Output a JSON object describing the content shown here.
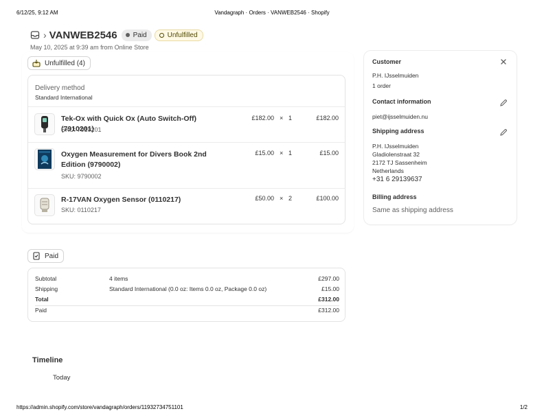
{
  "print": {
    "date": "6/12/25, 9:12 AM",
    "title": "Vandagraph · Orders · VANWEB2546 · Shopify",
    "url": "https://admin.shopify.com/store/vandagraph/orders/11932734751101",
    "page": "1/2"
  },
  "order": {
    "number": "VANWEB2546",
    "payment_badge": "Paid",
    "fulfillment_badge": "Unfulfilled",
    "subtitle": "May 10, 2025 at 9:39 am from Online Store"
  },
  "fulfillment": {
    "status_label": "Unfulfilled (4)",
    "delivery_method_title": "Delivery method",
    "delivery_method_value": "Standard International",
    "line_items": [
      {
        "name": "Tek-Ox with Quick Ox (Auto Switch-Off) (7910201)",
        "sku": "SKU: 7910201",
        "price": "£182.00",
        "times": "×",
        "qty": "1",
        "total": "£182.00",
        "thumb_icon": "oxygen-analyser-icon"
      },
      {
        "name": "Oxygen Measurement for Divers Book 2nd Edition (9790002)",
        "sku": "SKU: 9790002",
        "price": "£15.00",
        "times": "×",
        "qty": "1",
        "total": "£15.00",
        "thumb_icon": "book-cover-icon"
      },
      {
        "name": "R-17VAN Oxygen Sensor (0110217)",
        "sku": "SKU: 0110217",
        "price": "£50.00",
        "times": "×",
        "qty": "2",
        "total": "£100.00",
        "thumb_icon": "oxygen-sensor-icon"
      }
    ]
  },
  "payment": {
    "status_label": "Paid",
    "rows": [
      {
        "label": "Subtotal",
        "detail": "4 items",
        "value": "£297.00"
      },
      {
        "label": "Shipping",
        "detail": "Standard International (0.0 oz: Items 0.0 oz, Package 0.0 oz)",
        "value": "£15.00"
      },
      {
        "label": "Total",
        "detail": "",
        "value": "£312.00"
      },
      {
        "label": "Paid",
        "detail": "",
        "value": "£312.00"
      }
    ]
  },
  "customer": {
    "title": "Customer",
    "name": "P.H. IJsselmuiden",
    "orders": "1 order",
    "contact_title": "Contact information",
    "email": "piet@ijsselmuiden.nu",
    "shipping_title": "Shipping address",
    "shipping_lines": [
      "P.H. IJsselmuiden",
      "Gladiolenstraat 32",
      "2172 TJ Sassenheim",
      "Netherlands"
    ],
    "phone": "+31 6 29139637",
    "billing_title": "Billing address",
    "billing_value": "Same as shipping address"
  },
  "timeline": {
    "title": "Timeline",
    "today": "Today"
  },
  "colors": {
    "text": "#303030",
    "muted": "#616161",
    "unfulfilled_bg": "#fff9e5",
    "unfulfilled_text": "#4f4700",
    "border": "#e3e3e3"
  }
}
